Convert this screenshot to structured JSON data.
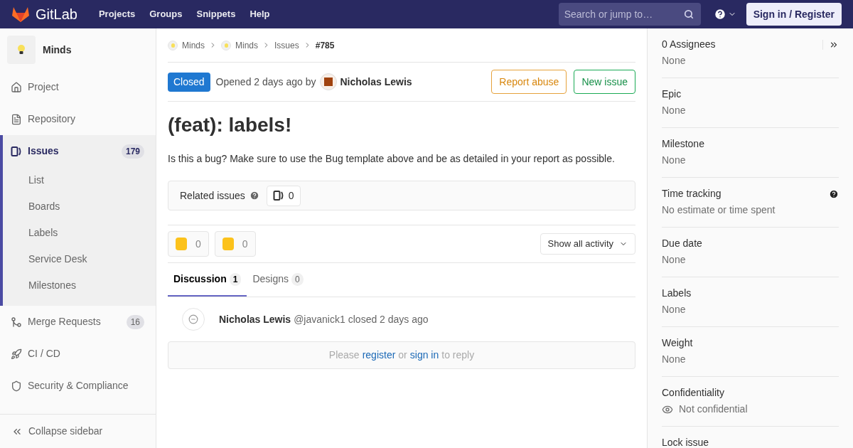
{
  "header": {
    "brand": "GitLab",
    "nav": [
      "Projects",
      "Groups",
      "Snippets",
      "Help"
    ],
    "search": {
      "placeholder": "Search or jump to…"
    },
    "sign_in": "Sign in / Register"
  },
  "sidebar": {
    "project": "Minds",
    "items": [
      {
        "label": "Project",
        "selected": false
      },
      {
        "label": "Repository",
        "selected": false
      },
      {
        "label": "Issues",
        "count": "179",
        "selected": true,
        "children": [
          {
            "label": "List"
          },
          {
            "label": "Boards"
          },
          {
            "label": "Labels"
          },
          {
            "label": "Service Desk"
          },
          {
            "label": "Milestones"
          }
        ]
      },
      {
        "label": "Merge Requests",
        "count": "16",
        "selected": false
      },
      {
        "label": "CI / CD",
        "selected": false
      },
      {
        "label": "Security & Compliance",
        "selected": false
      }
    ],
    "collapse": "Collapse sidebar"
  },
  "breadcrumbs": [
    "Minds",
    "Minds",
    "Issues",
    "#785"
  ],
  "issue": {
    "status": "Closed",
    "opened": "Opened 2 days ago by",
    "author": "Nicholas Lewis",
    "actions": [
      "Report abuse",
      "New issue"
    ],
    "title": "(feat): labels!",
    "description": "Is this a bug? Make sure to use the Bug template above and be as detailed in your report as possible.",
    "related": {
      "label": "Related issues",
      "count": "0"
    },
    "reactions": [
      {
        "count": "0"
      },
      {
        "count": "0"
      }
    ],
    "activity_filter": "Show all activity"
  },
  "tabs": [
    {
      "label": "Discussion",
      "count": "1",
      "selected": true
    },
    {
      "label": "Designs",
      "count": "0",
      "selected": false
    }
  ],
  "note": {
    "author": "Nicholas Lewis",
    "handle": "@javanick1",
    "action": "closed 2 days ago"
  },
  "reply": {
    "before": "Please",
    "register": "register",
    "middle": "or",
    "sign_in": "sign in",
    "after": "to reply"
  },
  "right_sidebar": {
    "sections": [
      {
        "title": "0 Assignees",
        "value": "None"
      },
      {
        "title": "Epic",
        "value": "None"
      },
      {
        "title": "Milestone",
        "value": "None"
      },
      {
        "title": "Time tracking",
        "value": "No estimate or time spent"
      },
      {
        "title": "Due date",
        "value": "None"
      },
      {
        "title": "Labels",
        "value": "None"
      },
      {
        "title": "Weight",
        "value": "None"
      },
      {
        "title": "Confidentiality",
        "value": "Not confidential"
      },
      {
        "title": "Lock issue"
      }
    ]
  }
}
